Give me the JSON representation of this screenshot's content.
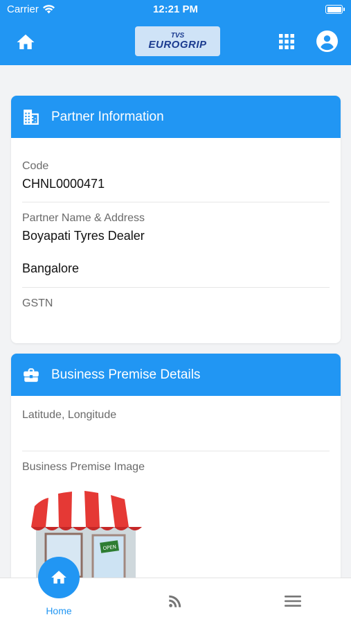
{
  "status_bar": {
    "carrier": "Carrier",
    "time": "12:21 PM"
  },
  "app_bar": {
    "logo_top": "TVS",
    "logo_bottom": "EUROGRIP"
  },
  "partner_card": {
    "title": "Partner Information",
    "code_label": "Code",
    "code_value": "CHNL0000471",
    "name_label": "Partner Name & Address",
    "name_value": "Boyapati Tyres Dealer",
    "address_value": "Bangalore",
    "gstn_label": "GSTN",
    "gstn_value": ""
  },
  "premise_card": {
    "title": "Business Premise Details",
    "latlng_label": "Latitude, Longitude",
    "latlng_value": "",
    "image_label": "Business Premise Image",
    "image_sign_text": "OPEN"
  },
  "bottom_nav": {
    "home_label": "Home"
  },
  "colors": {
    "primary": "#2196f3",
    "background": "#f2f3f5",
    "awning_red": "#e53935"
  },
  "icons": [
    "home-icon",
    "apps-grid-icon",
    "account-circle-icon",
    "building-icon",
    "briefcase-icon",
    "rss-feed-icon",
    "hamburger-menu-icon"
  ]
}
